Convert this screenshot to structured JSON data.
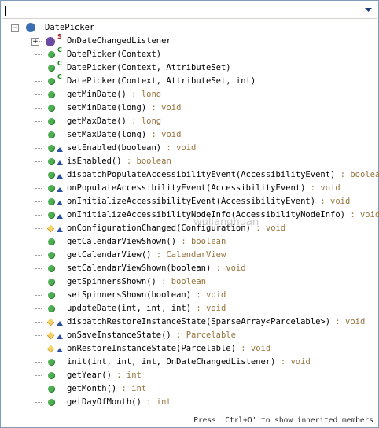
{
  "filter": {
    "value": ""
  },
  "root": {
    "label": "DatePicker"
  },
  "status_text": "Press 'Ctrl+O' to show inherited members",
  "watermark": "wulianghuan",
  "members": [
    {
      "name": "OnDateChangedListener",
      "type": "",
      "icon": "interface-icon",
      "kind": "interface",
      "sup": "S",
      "override": false,
      "expandable": true
    },
    {
      "name": "DatePicker(Context)",
      "type": "",
      "icon": "constructor-icon",
      "kind": "pub",
      "sup": "C",
      "override": false
    },
    {
      "name": "DatePicker(Context, AttributeSet)",
      "type": "",
      "icon": "constructor-icon",
      "kind": "pub",
      "sup": "C",
      "override": false
    },
    {
      "name": "DatePicker(Context, AttributeSet, int)",
      "type": "",
      "icon": "constructor-icon",
      "kind": "pub",
      "sup": "C",
      "override": false
    },
    {
      "name": "getMinDate()",
      "type": " : long",
      "icon": "public-method-icon",
      "kind": "pub",
      "override": false
    },
    {
      "name": "setMinDate(long)",
      "type": " : void",
      "icon": "public-method-icon",
      "kind": "pub",
      "override": false
    },
    {
      "name": "getMaxDate()",
      "type": " : long",
      "icon": "public-method-icon",
      "kind": "pub",
      "override": false
    },
    {
      "name": "setMaxDate(long)",
      "type": " : void",
      "icon": "public-method-icon",
      "kind": "pub",
      "override": false
    },
    {
      "name": "setEnabled(boolean)",
      "type": " : void",
      "icon": "public-method-icon",
      "kind": "pub",
      "override": true
    },
    {
      "name": "isEnabled()",
      "type": " : boolean",
      "icon": "public-method-icon",
      "kind": "pub",
      "override": true
    },
    {
      "name": "dispatchPopulateAccessibilityEvent(AccessibilityEvent)",
      "type": " : boolean",
      "icon": "public-method-icon",
      "kind": "pub",
      "override": true
    },
    {
      "name": "onPopulateAccessibilityEvent(AccessibilityEvent)",
      "type": " : void",
      "icon": "public-method-icon",
      "kind": "pub",
      "override": true
    },
    {
      "name": "onInitializeAccessibilityEvent(AccessibilityEvent)",
      "type": " : void",
      "icon": "public-method-icon",
      "kind": "pub",
      "override": true
    },
    {
      "name": "onInitializeAccessibilityNodeInfo(AccessibilityNodeInfo)",
      "type": " : void",
      "icon": "public-method-icon",
      "kind": "pub",
      "override": true
    },
    {
      "name": "onConfigurationChanged(Configuration)",
      "type": " : void",
      "icon": "protected-method-icon",
      "kind": "prot",
      "override": true
    },
    {
      "name": "getCalendarViewShown()",
      "type": " : boolean",
      "icon": "public-method-icon",
      "kind": "pub",
      "override": false
    },
    {
      "name": "getCalendarView()",
      "type": " : CalendarView",
      "icon": "public-method-icon",
      "kind": "pub",
      "override": false
    },
    {
      "name": "setCalendarViewShown(boolean)",
      "type": " : void",
      "icon": "public-method-icon",
      "kind": "pub",
      "override": false
    },
    {
      "name": "getSpinnersShown()",
      "type": " : boolean",
      "icon": "public-method-icon",
      "kind": "pub",
      "override": false
    },
    {
      "name": "setSpinnersShown(boolean)",
      "type": " : void",
      "icon": "public-method-icon",
      "kind": "pub",
      "override": false
    },
    {
      "name": "updateDate(int, int, int)",
      "type": " : void",
      "icon": "public-method-icon",
      "kind": "pub",
      "override": false
    },
    {
      "name": "dispatchRestoreInstanceState(SparseArray<Parcelable>)",
      "type": " : void",
      "icon": "protected-method-icon",
      "kind": "prot",
      "override": true
    },
    {
      "name": "onSaveInstanceState()",
      "type": " : Parcelable",
      "icon": "protected-method-icon",
      "kind": "prot",
      "override": true
    },
    {
      "name": "onRestoreInstanceState(Parcelable)",
      "type": " : void",
      "icon": "protected-method-icon",
      "kind": "prot",
      "override": true
    },
    {
      "name": "init(int, int, int, OnDateChangedListener)",
      "type": " : void",
      "icon": "public-method-icon",
      "kind": "pub",
      "override": false
    },
    {
      "name": "getYear()",
      "type": " : int",
      "icon": "public-method-icon",
      "kind": "pub",
      "override": false
    },
    {
      "name": "getMonth()",
      "type": " : int",
      "icon": "public-method-icon",
      "kind": "pub",
      "override": false
    },
    {
      "name": "getDayOfMonth()",
      "type": " : int",
      "icon": "public-method-icon",
      "kind": "pub",
      "override": false
    }
  ]
}
